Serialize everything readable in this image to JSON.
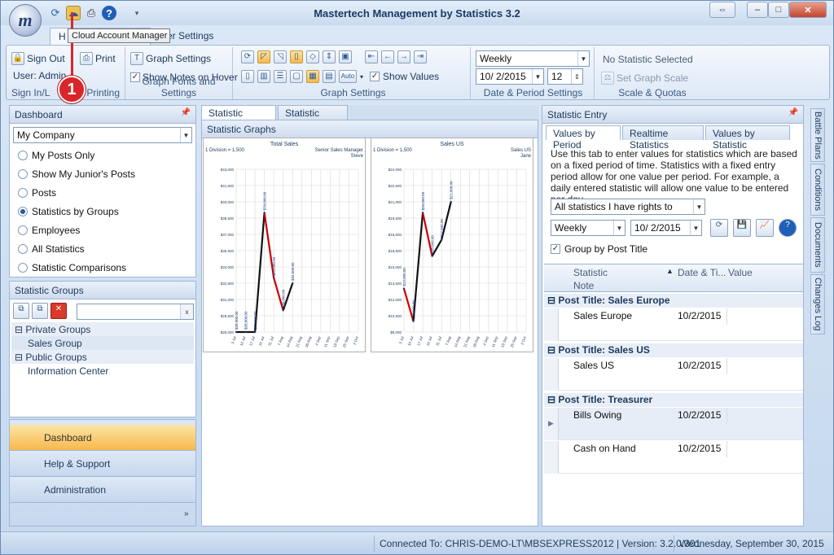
{
  "app": {
    "title": "Mastertech Management by Statistics 3.2",
    "logo_letter": "m"
  },
  "quick_access": [
    "refresh-icon",
    "cloud-account-icon",
    "print-icon",
    "help-icon"
  ],
  "tooltip": "Cloud Account Manager",
  "marker": "1",
  "tabs": {
    "home": "H",
    "other": "er Settings"
  },
  "ribbon": {
    "signin": {
      "sign_out": "Sign Out",
      "print": "Print",
      "user": "User: Admin",
      "title_left": "Sign In/L",
      "title_right": "Printing"
    },
    "graph_fonts": {
      "graph_settings": "Graph Settings",
      "show_notes": "Show Notes on Hover",
      "title": "Graph Fonts and Settings"
    },
    "graph": {
      "show_values": "Show Values",
      "auto": "Auto",
      "title": "Graph Settings"
    },
    "date": {
      "period": "Weekly",
      "date": "10/  2/2015",
      "count": "12",
      "title": "Date & Period Settings"
    },
    "scale": {
      "none_selected": "No Statistic Selected",
      "set_scale": "Set Graph Scale",
      "title": "Scale & Quotas"
    }
  },
  "dashboard": {
    "title": "Dashboard",
    "company": "My Company",
    "options": [
      "My Posts Only",
      "Show My Junior's Posts",
      "Posts",
      "Statistics by Groups",
      "Employees",
      "All Statistics",
      "Statistic Comparisons"
    ],
    "selected_index": 3
  },
  "stat_groups": {
    "title": "Statistic Groups",
    "search_clear": "x",
    "tree": [
      "Private Groups",
      "Sales Group",
      "Public Groups",
      "Information Center"
    ]
  },
  "nav": [
    "Dashboard",
    "Help & Support",
    "Administration"
  ],
  "center": {
    "tabs": [
      "Statistic Graphs",
      "Statistic Report"
    ],
    "header": "Statistic Graphs",
    "charts": [
      {
        "title": "Total Sales",
        "division": "1 Division = 1,500",
        "owner": "Senior Sales Manager",
        "owner2": "Steve"
      },
      {
        "title": "Sales US",
        "division": "1 Division = 1,500",
        "owner": "Sales US",
        "owner2": "Jane"
      }
    ]
  },
  "chart_data": [
    {
      "type": "line",
      "title": "Total Sales",
      "x": [
        "3 Jul",
        "10 Jul",
        "17 Jul",
        "24 Jul",
        "31 Jul",
        "7 Aug",
        "14 Aug",
        "21 Aug",
        "28 Aug",
        "4 Sep",
        "11 Sep",
        "18 Sep",
        "25 Sep",
        "2 Oct"
      ],
      "series": [
        {
          "values": [
            28000,
            28000,
            28000,
            39000,
            33000,
            30000,
            32500
          ]
        }
      ],
      "yticks": [
        "$28,000",
        "$29,500",
        "$31,000",
        "$32,500",
        "$34,000",
        "$35,500",
        "$37,000",
        "$38,500",
        "$40,000",
        "$41,500",
        "$43,000"
      ],
      "ylim": [
        28000,
        43000
      ]
    },
    {
      "type": "line",
      "title": "Sales US",
      "x": [
        "3 Jul",
        "10 Jul",
        "17 Jul",
        "24 Jul",
        "31 Jul",
        "7 Aug",
        "14 Aug",
        "21 Aug",
        "28 Aug",
        "4 Sep",
        "11 Sep",
        "18 Sep",
        "25 Sep",
        "2 Oct"
      ],
      "series": [
        {
          "values": [
            13000,
            10000,
            20000,
            16000,
            17500,
            21000
          ]
        }
      ],
      "yticks": [
        "$9,000",
        "$10,500",
        "$12,000",
        "$13,500",
        "$15,000",
        "$16,500",
        "$18,000",
        "$19,500",
        "$21,000",
        "$22,500",
        "$24,000"
      ],
      "ylim": [
        9000,
        24000
      ]
    }
  ],
  "entry": {
    "title": "Statistic Entry",
    "tabs": [
      "Values by Period",
      "Realtime Statistics",
      "Values by Statistic"
    ],
    "help": "Use this tab to enter values for statistics which are based on a fixed period of time. Statistics with a fixed entry period allow for one value per period. For example, a daily entered statistic will allow one value to be entered per day.",
    "filter": "All statistics I have rights to",
    "period": "Weekly",
    "date": "10/  2/2015",
    "group_by": "Group by Post Title",
    "columns": {
      "statistic": "Statistic",
      "date": "Date & Ti...",
      "value": "Value",
      "note": "Note"
    },
    "groups": [
      {
        "title": "Post Title:  Sales Europe",
        "rows": [
          {
            "name": "Sales Europe",
            "date": "10/2/2015"
          }
        ]
      },
      {
        "title": "Post Title:  Sales US",
        "rows": [
          {
            "name": "Sales US",
            "date": "10/2/2015"
          }
        ]
      },
      {
        "title": "Post Title:  Treasurer",
        "rows": [
          {
            "name": "Bills Owing",
            "date": "10/2/2015"
          },
          {
            "name": "Cash on Hand",
            "date": "10/2/2015"
          }
        ]
      }
    ]
  },
  "side_tabs": [
    "Battle Plans",
    "Conditions",
    "Documents",
    "Changes Log"
  ],
  "status": {
    "connection": "Connected To: CHRIS-DEMO-LT\\MBSEXPRESS2012 | Version: 3.2.0.301",
    "date": "Wednesday, September 30, 2015"
  },
  "colors": {
    "accent": "#f7b94c",
    "red": "#cc0000",
    "navy": "#1e395b"
  }
}
